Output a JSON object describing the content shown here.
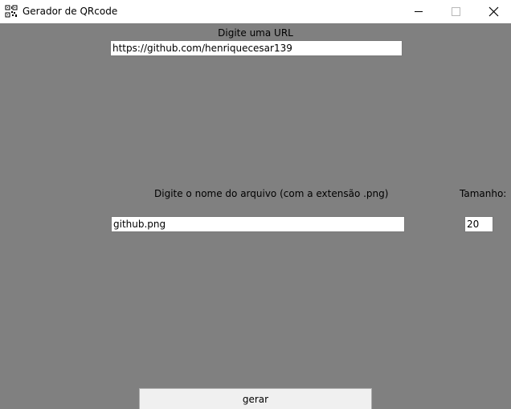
{
  "window": {
    "title": "Gerador de QRcode",
    "icon": "qr-code-icon",
    "controls": {
      "minimize_icon": "minimize-icon",
      "maximize_icon": "maximize-icon",
      "close_icon": "close-icon"
    }
  },
  "form": {
    "url_label": "Digite uma URL",
    "url_value": "https://github.com/henriquecesar139",
    "filename_label": "Digite o nome do arquivo (com a extensão .png)",
    "filename_value": "github.png",
    "size_label": "Tamanho:",
    "size_value": "20",
    "submit_label": "gerar"
  },
  "colors": {
    "window_background": "#808080",
    "titlebar_background": "#ffffff",
    "button_background": "#f0f0f0",
    "input_background": "#ffffff"
  }
}
